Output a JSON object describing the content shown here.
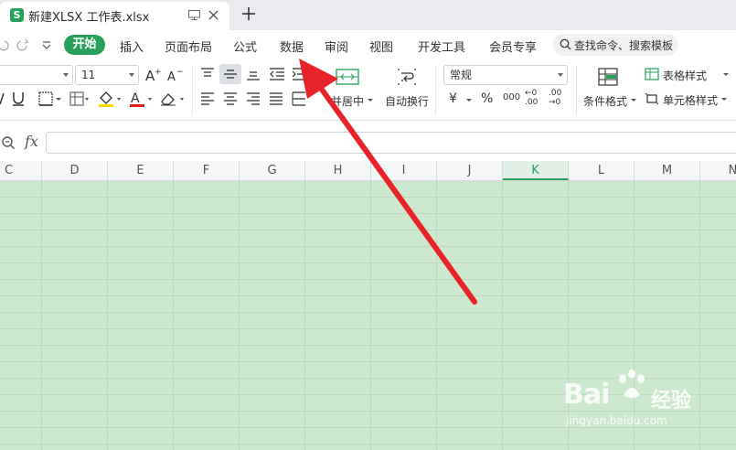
{
  "window": {
    "doc_title": "新建XLSX 工作表.xlsx",
    "app_badge": "S"
  },
  "menu": {
    "active_tab": "开始",
    "tabs": [
      "插入",
      "页面布局",
      "公式",
      "数据",
      "审阅",
      "视图",
      "开发工具",
      "会员专享"
    ],
    "search_placeholder": "查找命令、搜索模板"
  },
  "ribbon": {
    "font_size": "11",
    "merge_label": "并居中",
    "wrap_label": "自动换行",
    "number_format": "常规",
    "conditional_format_label": "条件格式",
    "table_style_label": "表格样式",
    "cell_style_label": "单元格样式",
    "currency_symbol": "¥",
    "percent_symbol": "%",
    "thousands_label": "000",
    "inc_decimal_label": "←0 .00",
    "dec_decimal_label": ".00 →0"
  },
  "formula_bar": {
    "fx_label": "fx",
    "value": ""
  },
  "sheet": {
    "columns": [
      "C",
      "D",
      "E",
      "F",
      "G",
      "H",
      "I",
      "J",
      "K",
      "L",
      "M",
      "N"
    ],
    "selected_column": "K",
    "grid_color": "#cce8cf",
    "accent": "#27a05c"
  },
  "watermark": {
    "brand": "Bai",
    "brand_cn": "经验",
    "url": "jingyan.baidu.com"
  },
  "annotation": {
    "color": "#e8232a",
    "points_to": "数据"
  }
}
